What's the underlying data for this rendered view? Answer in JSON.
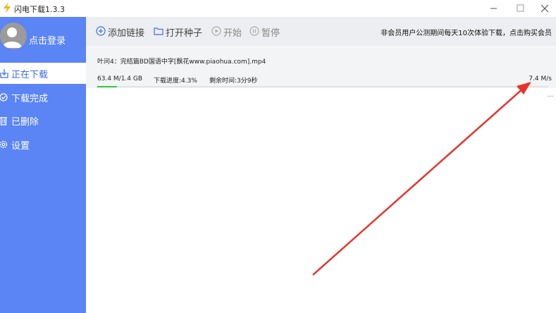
{
  "window": {
    "title": "闪电下载1.3.3",
    "app_icon": "lightning-icon",
    "controls": [
      "minimize-icon",
      "maximize-icon",
      "close-icon"
    ]
  },
  "sidebar": {
    "login_label": "点击登录",
    "items": [
      {
        "label": "正在下载",
        "icon": "download-icon",
        "active": true
      },
      {
        "label": "下载完成",
        "icon": "check-circle-icon",
        "active": false
      },
      {
        "label": "已删除",
        "icon": "trash-icon",
        "active": false
      },
      {
        "label": "设置",
        "icon": "gear-icon",
        "active": false
      }
    ]
  },
  "toolbar": {
    "add_link_label": "添加链接",
    "open_seed_label": "打开种子",
    "start_label": "开始",
    "pause_label": "暂停",
    "promo_text": "非会员用户公测期间每天10次体验下载，点击购买会员"
  },
  "task": {
    "name": "叶问4：完结篇BD国语中字[飘花www.piaohua.com].mp4",
    "size": "63.4 M/1.4 GB",
    "progress_text": "下载进度:4.3%",
    "progress": 0.043,
    "remaining": "剩余时间:3分9秒",
    "speed": "7.4 M/s",
    "more": "..."
  },
  "colors": {
    "sidebar": "#5b84f4",
    "accent": "#3a6cf0",
    "progress": "#2ecc40",
    "annotation_arrow": "#e8322a"
  }
}
